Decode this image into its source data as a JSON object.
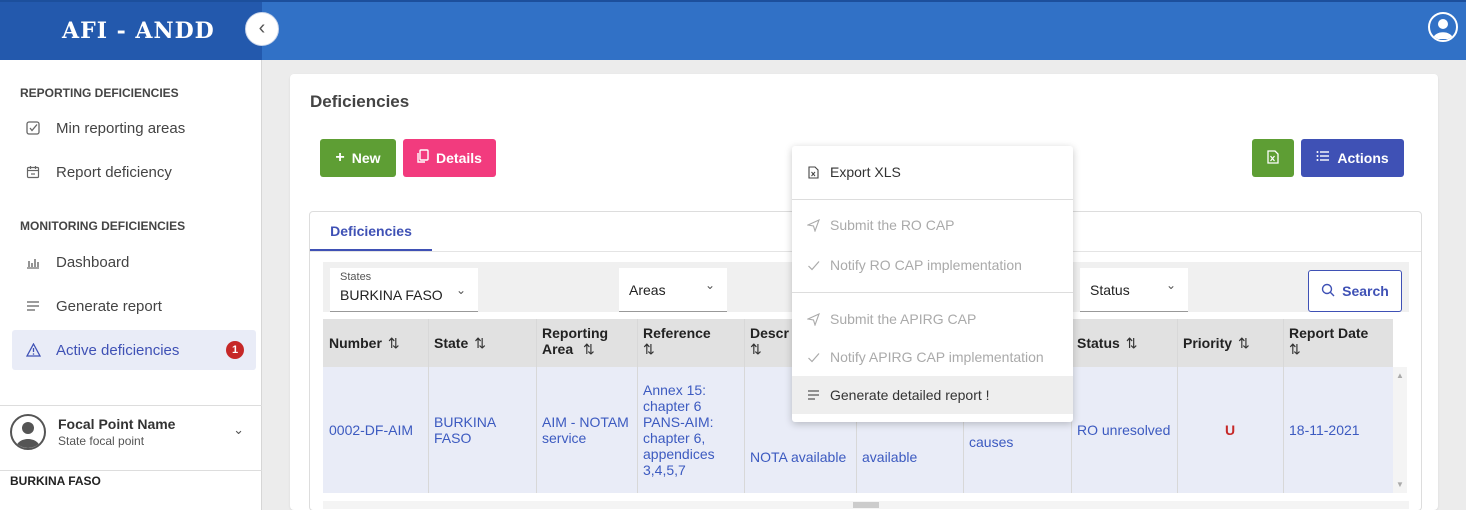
{
  "app": {
    "title": "AFI - ANDD"
  },
  "sidebar": {
    "section1": "REPORTING DEFICIENCIES",
    "section2": "MONITORING DEFICIENCIES",
    "items": [
      {
        "label": "Min reporting areas",
        "icon": "checkbox-icon"
      },
      {
        "label": "Report deficiency",
        "icon": "calendar-icon"
      },
      {
        "label": "Dashboard",
        "icon": "bar-chart-icon"
      },
      {
        "label": "Generate report",
        "icon": "lines-icon"
      },
      {
        "label": "Active deficiencies",
        "icon": "warning-icon",
        "badge": "1"
      }
    ],
    "profile": {
      "name": "Focal Point Name",
      "role": "State focal point"
    },
    "country": "BURKINA FASO"
  },
  "page": {
    "title": "Deficiencies",
    "buttons": {
      "new": "New",
      "details": "Details",
      "actions": "Actions"
    },
    "tab": "Deficiencies",
    "filters": {
      "states_label": "States",
      "states_value": "BURKINA FASO",
      "areas_value": "Areas",
      "status_value": "Status",
      "search": "Search"
    }
  },
  "table": {
    "columns": {
      "number": "Number",
      "state": "State",
      "reporting_area": "Reporting Area",
      "reference": "Reference",
      "description": "Descr",
      "status": "Status",
      "priority": "Priority",
      "report_date": "Report Date"
    },
    "rows": [
      {
        "number": "0002-DF-AIM",
        "state": "BURKINA FASO",
        "area": "AIM - NOTAM service",
        "reference": "Annex 15: chapter 6 PANS-AIM: chapter 6, appendices 3,4,5,7",
        "description": "NOTA available",
        "col6": "available",
        "col7": "causes",
        "status": "RO unresolved",
        "priority": "U",
        "report_date": "18-11-2021"
      }
    ]
  },
  "menu": {
    "items": [
      {
        "label": "Export XLS",
        "icon": "xls-file-icon",
        "disabled": false
      },
      {
        "label": "Submit the RO CAP",
        "icon": "send-icon",
        "disabled": true
      },
      {
        "label": "Notify RO CAP implementation",
        "icon": "check-icon",
        "disabled": true
      },
      {
        "label": "Submit the APIRG CAP",
        "icon": "send-icon",
        "disabled": true
      },
      {
        "label": "Notify APIRG CAP implementation",
        "icon": "check-icon",
        "disabled": true
      },
      {
        "label": "Generate detailed report !",
        "icon": "lines-icon",
        "disabled": false
      }
    ]
  },
  "colors": {
    "topbar": "#3171c6",
    "brand": "#2359ad",
    "primary": "#3f51b5",
    "green": "#5e9e34",
    "pink": "#f23b7e",
    "priority": "#c62828"
  }
}
